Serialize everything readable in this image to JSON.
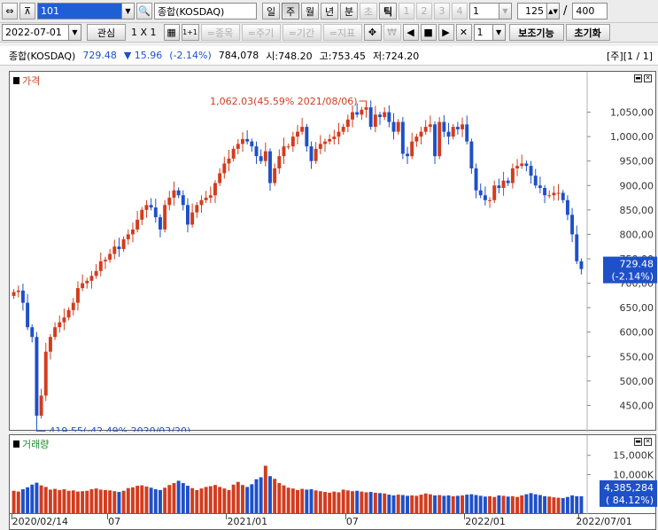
{
  "toolbar1": {
    "code": "101",
    "name": "종합(KOSDAQ)",
    "periods": [
      "일",
      "주",
      "월",
      "년",
      "분",
      "초",
      "틱"
    ],
    "period_active": "주",
    "minute_buttons": [
      "1",
      "2",
      "3",
      "4"
    ],
    "minute_value": "1",
    "count_value": "125",
    "count_sep": "/",
    "count_total": "400"
  },
  "toolbar2": {
    "date": "2022-07-01",
    "interest": "관심",
    "layout": "1 X 1",
    "grid_label": "1+1",
    "tabs": [
      "=종목",
      "=주기",
      "=기간",
      "=지표"
    ],
    "divider": "1",
    "sub_indicator": "보조기능",
    "reset": "초기화"
  },
  "info": {
    "name": "종합(KOSDAQ)",
    "price": "729.48",
    "change": "▼ 15.96",
    "change_pct": "(-2.14%)",
    "volume": "784,078",
    "open": "시:748.20",
    "high": "고:753.45",
    "low": "저:724.20",
    "page": "[주][1 / 1]"
  },
  "panels": {
    "price_label": "가격",
    "volume_label": "거래량",
    "current_price_tag": "729.48",
    "current_price_pct": "(-2.14%)",
    "current_volume_tag": "4,385,284",
    "current_volume_pct": "( 84.12%)",
    "high_annotation": "1,062.03(45.59% 2021/08/06)",
    "low_annotation": "419.55(-42.49% 2020/03/20)"
  },
  "colors": {
    "up": "#d23c1e",
    "down": "#1e50c8"
  },
  "chart_data": {
    "type": "candlestick",
    "ylim": [
      400,
      1100
    ],
    "yticks": [
      450,
      500,
      550,
      600,
      650,
      700,
      750,
      800,
      850,
      900,
      950,
      1000,
      1050
    ],
    "ytick_labels": [
      "450,00",
      "500,00",
      "550,00",
      "600,00",
      "650,00",
      "700,00",
      "750,00",
      "800,00",
      "850,00",
      "900,00",
      "950,00",
      "1,000,00",
      "1,050,00"
    ],
    "x_labels": [
      {
        "index": 0,
        "label": "2020/02/14"
      },
      {
        "index": 21,
        "label": "07"
      },
      {
        "index": 47,
        "label": "2021/01"
      },
      {
        "index": 73,
        "label": "07"
      },
      {
        "index": 99,
        "label": "2022/01"
      },
      {
        "index": 124,
        "label": "2022/07/01"
      }
    ],
    "high_index": 77,
    "high_value": 1062.03,
    "low_index": 5,
    "low_value": 419.55,
    "close": [
      682,
      685,
      660,
      610,
      590,
      429,
      470,
      560,
      590,
      610,
      620,
      630,
      645,
      660,
      690,
      700,
      705,
      715,
      725,
      745,
      748,
      760,
      775,
      770,
      790,
      800,
      810,
      830,
      850,
      860,
      855,
      835,
      810,
      860,
      875,
      890,
      880,
      860,
      820,
      845,
      860,
      870,
      875,
      880,
      905,
      925,
      945,
      955,
      975,
      985,
      995,
      990,
      980,
      960,
      950,
      970,
      905,
      935,
      960,
      980,
      980,
      1000,
      1010,
      1020,
      980,
      950,
      975,
      985,
      990,
      995,
      1000,
      1010,
      1020,
      1035,
      1050,
      1045,
      1055,
      1060,
      1020,
      1045,
      1040,
      1050,
      1030,
      1010,
      1030,
      965,
      960,
      990,
      1000,
      1010,
      1020,
      1025,
      960,
      1030,
      1010,
      1000,
      1020,
      1015,
      1025,
      990,
      935,
      890,
      880,
      870,
      870,
      900,
      895,
      910,
      905,
      935,
      940,
      945,
      940,
      920,
      900,
      895,
      880,
      880,
      885,
      885,
      870,
      840,
      800,
      745,
      729
    ],
    "volume_millions": [
      5.8,
      5.6,
      6.2,
      6.7,
      7.4,
      7.9,
      7.2,
      6.8,
      6.1,
      6.3,
      6.0,
      6.2,
      5.8,
      5.9,
      5.6,
      5.7,
      5.8,
      6.2,
      6.4,
      6.1,
      6.0,
      5.9,
      5.7,
      5.5,
      5.8,
      6.5,
      6.7,
      7.1,
      7.2,
      6.9,
      6.6,
      6.2,
      6.0,
      6.6,
      7.3,
      7.8,
      8.4,
      7.8,
      7.1,
      6.5,
      6.0,
      6.4,
      6.8,
      7.0,
      7.3,
      6.8,
      6.4,
      6.0,
      7.4,
      8.1,
      7.3,
      6.8,
      7.5,
      8.8,
      9.3,
      12.3,
      9.6,
      8.9,
      7.8,
      7.2,
      6.6,
      6.4,
      6.0,
      6.3,
      6.1,
      6.2,
      5.9,
      5.7,
      5.5,
      5.3,
      5.6,
      5.4,
      6.1,
      5.9,
      5.7,
      5.8,
      5.6,
      5.4,
      5.5,
      5.3,
      5.2,
      5.1,
      4.8,
      4.6,
      4.8,
      4.7,
      4.5,
      4.6,
      4.5,
      4.8,
      5.1,
      4.9,
      4.6,
      4.7,
      4.5,
      4.6,
      4.4,
      4.5,
      4.6,
      4.8,
      4.9,
      4.7,
      4.5,
      4.3,
      4.4,
      4.2,
      4.6,
      4.5,
      4.3,
      4.4,
      4.2,
      4.6,
      4.9,
      5.2,
      4.9,
      4.7,
      4.4,
      4.3,
      4.1,
      4.0,
      3.9,
      4.2,
      4.6,
      4.4,
      4.39
    ],
    "volume_ticks": [
      {
        "value": 10,
        "label": "10,000K"
      },
      {
        "value": 15,
        "label": "15,000K"
      }
    ],
    "volume_ylim": [
      0,
      17
    ]
  }
}
